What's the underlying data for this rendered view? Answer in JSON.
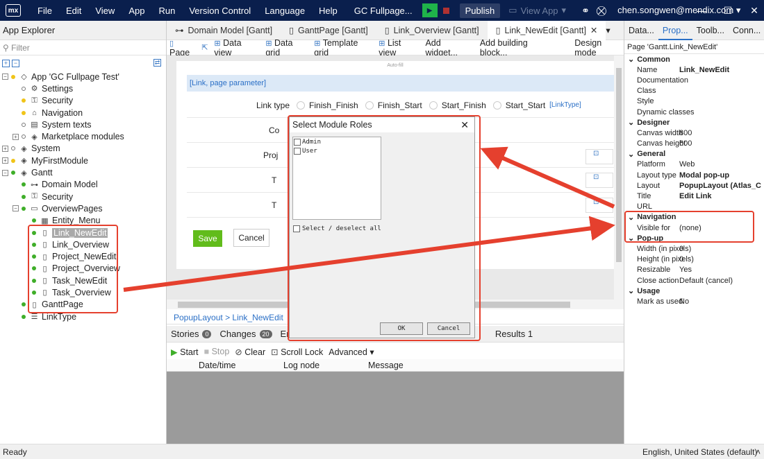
{
  "app": {
    "logo": "mx",
    "menu": [
      "File",
      "Edit",
      "View",
      "App",
      "Run",
      "Version Control",
      "Language",
      "Help"
    ],
    "project": "GC Fullpage...",
    "publish": "Publish",
    "view_app": "View App",
    "user": "chen.songwen@mendix.com"
  },
  "explorer": {
    "title": "App Explorer",
    "filter_placeholder": "Filter",
    "tree": [
      {
        "label": "App 'GC Fullpage Test'",
        "exp": "⊟",
        "dot": "y",
        "icon": "◇",
        "indent": 0
      },
      {
        "label": "Settings",
        "exp": "",
        "dot": "o",
        "icon": "⚙",
        "indent": 1
      },
      {
        "label": "Security",
        "exp": "",
        "dot": "y",
        "icon": "⚿",
        "indent": 1
      },
      {
        "label": "Navigation",
        "exp": "",
        "dot": "y",
        "icon": "⌂",
        "indent": 1
      },
      {
        "label": "System texts",
        "exp": "",
        "dot": "o",
        "icon": "▤",
        "indent": 1
      },
      {
        "label": "Marketplace modules",
        "exp": "⊞",
        "dot": "o",
        "icon": "◈",
        "indent": 1
      },
      {
        "label": "System",
        "exp": "⊞",
        "dot": "o",
        "icon": "◈",
        "indent": 0
      },
      {
        "label": "MyFirstModule",
        "exp": "⊞",
        "dot": "y",
        "icon": "◈",
        "indent": 0
      },
      {
        "label": "Gantt",
        "exp": "⊟",
        "dot": "g",
        "icon": "◈",
        "indent": 0
      },
      {
        "label": "Domain Model",
        "exp": "",
        "dot": "g",
        "icon": "⊶",
        "indent": 1
      },
      {
        "label": "Security",
        "exp": "",
        "dot": "g",
        "icon": "⚿",
        "indent": 1
      },
      {
        "label": "OverviewPages",
        "exp": "⊟",
        "dot": "g",
        "icon": "▭",
        "indent": 1
      },
      {
        "label": "Entity_Menu",
        "exp": "",
        "dot": "g",
        "icon": "▦",
        "indent": 2
      },
      {
        "label": "Link_NewEdit",
        "exp": "",
        "dot": "g",
        "icon": "▯",
        "indent": 2,
        "selected": true
      },
      {
        "label": "Link_Overview",
        "exp": "",
        "dot": "g",
        "icon": "▯",
        "indent": 2
      },
      {
        "label": "Project_NewEdit",
        "exp": "",
        "dot": "g",
        "icon": "▯",
        "indent": 2
      },
      {
        "label": "Project_Overview",
        "exp": "",
        "dot": "g",
        "icon": "▯",
        "indent": 2
      },
      {
        "label": "Task_NewEdit",
        "exp": "",
        "dot": "g",
        "icon": "▯",
        "indent": 2
      },
      {
        "label": "Task_Overview",
        "exp": "",
        "dot": "g",
        "icon": "▯",
        "indent": 2
      },
      {
        "label": "GanttPage",
        "exp": "",
        "dot": "g",
        "icon": "▯",
        "indent": 1
      },
      {
        "label": "LinkType",
        "exp": "",
        "dot": "g",
        "icon": "☰",
        "indent": 1
      }
    ]
  },
  "editor": {
    "tabs": [
      {
        "label": "Domain Model [Gantt]",
        "icon": "⊶"
      },
      {
        "label": "GanttPage [Gantt]",
        "icon": "▯"
      },
      {
        "label": "Link_Overview [Gantt]",
        "icon": "▯"
      },
      {
        "label": "Link_NewEdit [Gantt]",
        "icon": "▯",
        "active": true
      }
    ],
    "toolbar": [
      "Page",
      "Data view",
      "Data grid",
      "Template grid",
      "List view",
      "Add widget...",
      "Add building block..."
    ],
    "design_mode": "Design mode",
    "autofill": "Auto-fill",
    "param": "[Link, page parameter]",
    "link_type_label": "Link type",
    "radio_options": [
      "Finish_Finish",
      "Finish_Start",
      "Start_Finish",
      "Start_Start"
    ],
    "link_type_bind": "[LinkType]",
    "row_labels": [
      "Co",
      "Proj",
      "T",
      "T"
    ],
    "save": "Save",
    "cancel": "Cancel",
    "breadcrumb": "PopupLayout  >  Link_NewEdit"
  },
  "bottom": {
    "tabs": [
      {
        "label": "Stories",
        "badge": "0"
      },
      {
        "label": "Changes",
        "badge": "20"
      },
      {
        "label": "Err",
        "badge": ""
      },
      {
        "label": "Results 1",
        "badge": ""
      }
    ],
    "console_buttons": [
      "Start",
      "Stop",
      "Clear",
      "Scroll Lock",
      "Advanced"
    ],
    "columns": [
      "Date/time",
      "Log node",
      "Message"
    ]
  },
  "right": {
    "tabs": [
      "Data...",
      "Prop...",
      "Toolb...",
      "Conn..."
    ],
    "page_label": "Page 'Gantt.Link_NewEdit'",
    "properties": [
      {
        "cat": "Common"
      },
      {
        "k": "Name",
        "v": "Link_NewEdit",
        "b": true
      },
      {
        "k": "Documentation",
        "v": ""
      },
      {
        "k": "Class",
        "v": ""
      },
      {
        "k": "Style",
        "v": ""
      },
      {
        "k": "Dynamic classes",
        "v": ""
      },
      {
        "cat": "Designer"
      },
      {
        "k": "Canvas width",
        "v": "800"
      },
      {
        "k": "Canvas height",
        "v": "600"
      },
      {
        "cat": "General"
      },
      {
        "k": "Platform",
        "v": "Web"
      },
      {
        "k": "Layout type",
        "v": "Modal pop-up",
        "b": true
      },
      {
        "k": "Layout",
        "v": "PopupLayout (Atlas_C",
        "b": true
      },
      {
        "k": "Title",
        "v": "Edit Link",
        "b": true
      },
      {
        "k": "URL",
        "v": ""
      },
      {
        "cat": "Navigation"
      },
      {
        "k": "Visible for",
        "v": "(none)"
      },
      {
        "cat": "Pop-up"
      },
      {
        "k": "Width (in pixels)",
        "v": "0"
      },
      {
        "k": "Height (in pixels)",
        "v": "0"
      },
      {
        "k": "Resizable",
        "v": "Yes"
      },
      {
        "k": "Close action",
        "v": "Default (cancel)"
      },
      {
        "cat": "Usage"
      },
      {
        "k": "Mark as used",
        "v": "No"
      }
    ]
  },
  "dialog": {
    "title": "Select Module Roles",
    "roles": [
      "Admin",
      "User"
    ],
    "select_all": "Select / deselect all",
    "ok": "OK",
    "cancel": "Cancel"
  },
  "status": {
    "left": "Ready",
    "right": "English, United States (default)"
  },
  "colors": {
    "titlebar": "#0a1f4d",
    "accent": "#2a6fc6",
    "annotation": "#e5402e",
    "save": "#61bc1b"
  }
}
